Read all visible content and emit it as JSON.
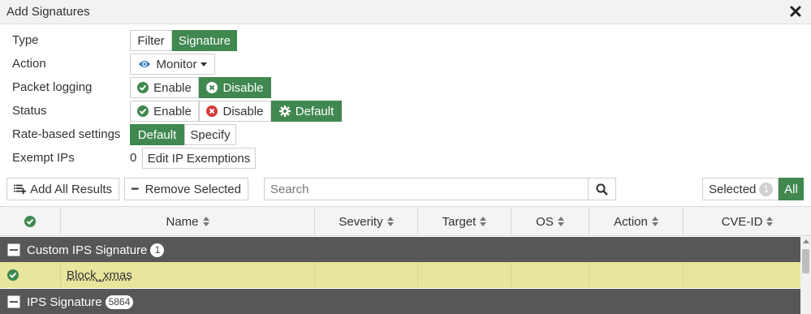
{
  "dialog": {
    "title": "Add Signatures"
  },
  "form": {
    "type": {
      "label": "Type",
      "options": [
        "Filter",
        "Signature"
      ],
      "selected": "Signature"
    },
    "action": {
      "label": "Action",
      "value": "Monitor"
    },
    "packet_logging": {
      "label": "Packet logging",
      "options": [
        "Enable",
        "Disable"
      ],
      "selected": "Disable"
    },
    "status": {
      "label": "Status",
      "options": [
        "Enable",
        "Disable",
        "Default"
      ],
      "selected": "Default"
    },
    "rate_based": {
      "label": "Rate-based settings",
      "options": [
        "Default",
        "Specify"
      ],
      "selected": "Default"
    },
    "exempt_ips": {
      "label": "Exempt IPs",
      "count": "0",
      "button": "Edit IP Exemptions"
    }
  },
  "toolbar": {
    "add_all": "Add All Results",
    "remove_selected": "Remove Selected",
    "search_placeholder": "Search",
    "selected_label": "Selected",
    "selected_count": "1",
    "all_label": "All"
  },
  "table": {
    "columns": [
      "Name",
      "Severity",
      "Target",
      "OS",
      "Action",
      "CVE-ID"
    ],
    "groups": [
      {
        "name": "Custom IPS Signature",
        "count": "1"
      },
      {
        "name": "IPS Signature",
        "count": "5864"
      }
    ],
    "rows": [
      {
        "name": "Block_xmas",
        "selected": true
      }
    ]
  },
  "colors": {
    "accent": "#40884f",
    "group_bg": "#575757",
    "selected_row": "#e8e59c"
  }
}
